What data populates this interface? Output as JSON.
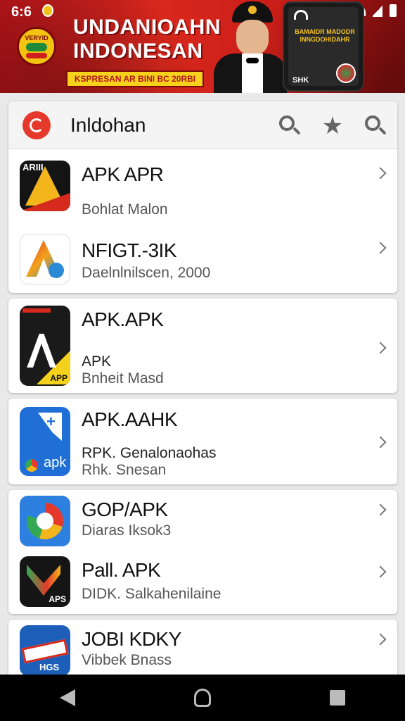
{
  "status_bar": {
    "time": "6:6"
  },
  "banner": {
    "badge_text": "VERYID",
    "title_line1": "UNDANIOAHN",
    "title_line2": "INDONESAN",
    "strip_text": "KSPRESAN AR BINI BC 20RBI",
    "phone_text": "BAMAIDR MADODR INNGDOHIDAHR",
    "phone_footer": "SHK"
  },
  "search_bar": {
    "title": "Inldohan",
    "icons": [
      "search-icon",
      "star-icon",
      "search-icon"
    ]
  },
  "groups": [
    {
      "items": [
        {
          "name": "APK APR",
          "sub": "Bohlat Malon",
          "icon": "apk-a-black-icon"
        },
        {
          "name": "NFIGT.-3IK",
          "sub": "Daelnlnilscen, 2000",
          "icon": "apk-gradient-icon"
        }
      ]
    },
    {
      "items": [
        {
          "name": "APK.APK",
          "sub": "APK",
          "sub2": "Bnheit Masd",
          "icon": "apk-app-icon"
        }
      ]
    },
    {
      "items": [
        {
          "name": "APK.AAHK",
          "sub": "RPK. Genalonaohas",
          "sub2": "Rhk. Snesan",
          "icon": "apk-blue-icon"
        }
      ]
    },
    {
      "items": [
        {
          "name": "GOP/APK",
          "sub": "Diaras Iksok3",
          "icon": "apk-ring-icon"
        },
        {
          "name": "Pall. APK",
          "sub": "DIDK. Salkahenilaine",
          "icon": "apk-v-icon"
        }
      ]
    },
    {
      "items": [
        {
          "name": "JOBI KDKY",
          "sub": "Vibbek Bnass",
          "icon": "apk-stamp-icon"
        }
      ]
    }
  ],
  "group_icon_text": {
    "a1": "ARIII",
    "a3": "APP",
    "a4": "apk",
    "a6": "APS",
    "a7": "HGS"
  },
  "colors": {
    "banner_red": "#c81d18",
    "accent": "#e53a2b",
    "nav": "#000000"
  }
}
